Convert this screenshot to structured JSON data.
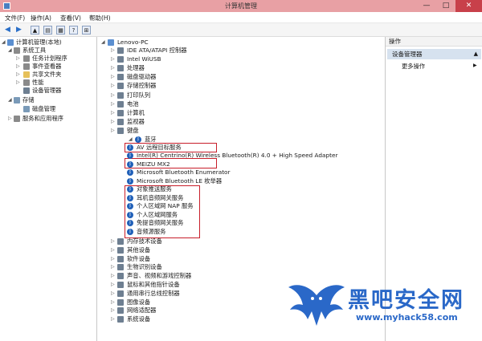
{
  "window": {
    "title": "计算机管理",
    "min": "—",
    "max": "□",
    "close": "✕"
  },
  "menu": [
    "文件(F)",
    "操作(A)",
    "查看(V)",
    "帮助(H)"
  ],
  "left_tree": [
    {
      "label": "计算机管理(本地)",
      "level": 0,
      "arrow": "◢",
      "icon": "pc"
    },
    {
      "label": "系统工具",
      "level": 1,
      "arrow": "◢",
      "icon": "tool"
    },
    {
      "label": "任务计划程序",
      "level": 2,
      "arrow": "▷",
      "icon": "tool"
    },
    {
      "label": "事件查看器",
      "level": 2,
      "arrow": "▷",
      "icon": "tool"
    },
    {
      "label": "共享文件夹",
      "level": 2,
      "arrow": "▷",
      "icon": "folder"
    },
    {
      "label": "性能",
      "level": 2,
      "arrow": "▷",
      "icon": "tool"
    },
    {
      "label": "设备管理器",
      "level": 2,
      "arrow": "",
      "icon": "dev"
    },
    {
      "label": "存储",
      "level": 1,
      "arrow": "◢",
      "icon": "store"
    },
    {
      "label": "磁盘管理",
      "level": 2,
      "arrow": "",
      "icon": "store"
    },
    {
      "label": "服务和应用程序",
      "level": 1,
      "arrow": "▷",
      "icon": "tool"
    }
  ],
  "device_tree": {
    "root": "Lenovo-PC",
    "categories_before": [
      "IDE ATA/ATAPI 控制器",
      "Intel WiUSB",
      "处理器",
      "磁盘驱动器",
      "存储控制器",
      "打印队列",
      "电池",
      "计算机",
      "监视器",
      "键盘"
    ],
    "expanded_category": "蓝牙",
    "bluetooth_items": [
      "AV 远程目标服务",
      "Intel(R) Centrino(R) Wireless Bluetooth(R) 4.0 + High Speed Adapter",
      "MEIZU MX2",
      "Microsoft Bluetooth Enumerator",
      "Microsoft Bluetooth LE 枚举器",
      "对象推送服务",
      "耳机音频网关服务",
      "个人区域网 NAP 服务",
      "个人区域网服务",
      "免提音频网关服务",
      "音频源服务"
    ],
    "categories_after": [
      "内存技术设备",
      "其他设备",
      "软件设备",
      "生物识别设备",
      "声音、视频和游戏控制器",
      "鼠标和其他指针设备",
      "通用串行总线控制器",
      "图像设备",
      "网络适配器",
      "系统设备"
    ]
  },
  "actions": {
    "header": "操作",
    "selected": "设备管理器",
    "more": "更多操作"
  },
  "watermark": {
    "name": "黑吧安全网",
    "url": "www.myhack58.com"
  },
  "colors": {
    "titlebar": "#e8a0a4",
    "close": "#c8404a",
    "highlight": "#c81e2a",
    "selection": "#d6e2ef",
    "watermark": "#2a68c8"
  }
}
